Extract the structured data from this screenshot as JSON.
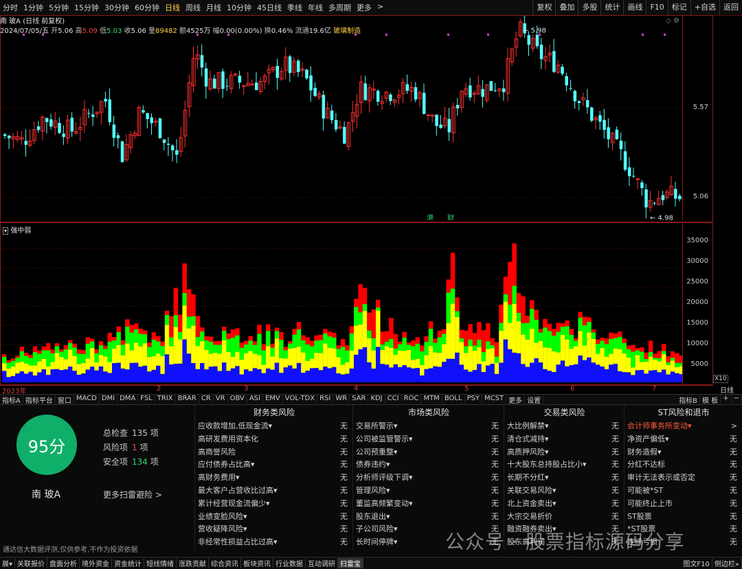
{
  "topbar": {
    "periods": [
      "分时",
      "1分钟",
      "5分钟",
      "15分钟",
      "30分钟",
      "60分钟",
      "日线",
      "周线",
      "月线",
      "10分钟",
      "45日线",
      "季线",
      "年线",
      "多周期",
      "更多"
    ],
    "active": "日线",
    "more_arrow": ">",
    "right_buttons": [
      "复权",
      "叠加",
      "多股",
      "统计",
      "画线",
      "F10",
      "标记",
      "+自选",
      "返回"
    ]
  },
  "chart_header": {
    "name": "南 玻A",
    "adj": "(日线 前复权)",
    "date": "2024/07/05/五",
    "open_label": "开",
    "open": "5.06",
    "high_label": "高",
    "high": "5.09",
    "low_label": "低",
    "low": "5.03",
    "close_label": "收",
    "close": "5.06",
    "vol_label": "量",
    "vol": "89482",
    "amt_label": "额",
    "amt": "4525万",
    "chg_label": "幅",
    "chg": "0.00(0.00%)",
    "turn_label": "换",
    "turn": "0.46%",
    "float_label": "流通",
    "float": "19.6亿",
    "industry": "玻璃制造"
  },
  "price_axis": [
    "5.57",
    "5.06"
  ],
  "annotations": {
    "high": "5.98",
    "low": "4.98",
    "marker_gang": "港",
    "marker_cai": "财"
  },
  "volume_indicator": {
    "name": "强中弱"
  },
  "volume_axis": [
    "35000",
    "30000",
    "25000",
    "20000",
    "15000",
    "10000",
    "5000"
  ],
  "volume_scale": "X10",
  "dates": {
    "start": "2023年",
    "months": [
      "2",
      "3",
      "4",
      "5",
      "6",
      "7"
    ],
    "period": "日线"
  },
  "indicators": [
    "指标A",
    "指标平台",
    "窗口",
    "MACD",
    "DMI",
    "DMA",
    "FSL",
    "TRIX",
    "BRAR",
    "CR",
    "VR",
    "OBV",
    "ASI",
    "EMV",
    "VOL-TDX",
    "RSI",
    "WR",
    "SAR",
    "KDJ",
    "CCI",
    "ROC",
    "MTM",
    "BOLL",
    "PSY",
    "MCST",
    "更多",
    "设置"
  ],
  "indicators_right": [
    "指标B",
    "模 板",
    "+",
    "−"
  ],
  "scan": {
    "score": "95分",
    "stock_name": "南 玻A",
    "total_label": "总检查",
    "total": "135",
    "total_unit": "项",
    "risk_label": "风险项",
    "risk": "1",
    "risk_unit": "项",
    "safe_label": "安全项",
    "safe": "134",
    "safe_unit": "项",
    "more": "更多扫雷避险 >",
    "disclaimer": "通达信大数据评测,仅供参考,不作为投资依据",
    "columns": [
      {
        "title": "财务类风险",
        "rows": [
          {
            "label": "应收款增加,低现金流▾",
            "value": "无"
          },
          {
            "label": "高研发费用资本化",
            "value": "无"
          },
          {
            "label": "高商誉风险",
            "value": "无"
          },
          {
            "label": "应付债券占比高▾",
            "value": "无"
          },
          {
            "label": "高财务费用▾",
            "value": "无"
          },
          {
            "label": "最大客户占营收比过高▾",
            "value": "无"
          },
          {
            "label": "累计经营现金流偏少▾",
            "value": "无"
          },
          {
            "label": "业绩变脸风险▾",
            "value": "无"
          },
          {
            "label": "营收疑降风险▾",
            "value": "无"
          },
          {
            "label": "非经常性损益占比过高▾",
            "value": "无"
          }
        ]
      },
      {
        "title": "市场类风险",
        "rows": [
          {
            "label": "交易所警示▾",
            "value": "无"
          },
          {
            "label": "公司被监管警示▾",
            "value": "无"
          },
          {
            "label": "公司预重整▾",
            "value": "无"
          },
          {
            "label": "债券违约▾",
            "value": "无"
          },
          {
            "label": "分析师评级下调▾",
            "value": "无"
          },
          {
            "label": "管理风险▾",
            "value": "无"
          },
          {
            "label": "董监高频繁变动▾",
            "value": "无"
          },
          {
            "label": "股东退出▾",
            "value": "无"
          },
          {
            "label": "子公司风险▾",
            "value": "无"
          },
          {
            "label": "长时间停牌▾",
            "value": "无"
          }
        ]
      },
      {
        "title": "交易类风险",
        "rows": [
          {
            "label": "大比例解禁▾",
            "value": "无"
          },
          {
            "label": "清仓式减持▾",
            "value": "无"
          },
          {
            "label": "高质押风险▾",
            "value": "无"
          },
          {
            "label": "十大股东总持股占比小▾",
            "value": "无"
          },
          {
            "label": "长期不分红▾",
            "value": "无"
          },
          {
            "label": "关联交易风险▾",
            "value": "无"
          },
          {
            "label": "北上资金卖出▾",
            "value": "无"
          },
          {
            "label": "大宗交易折价",
            "value": "无"
          },
          {
            "label": "融资融券卖出▾",
            "value": "无"
          },
          {
            "label": "股东高利润",
            "value": "无"
          }
        ]
      },
      {
        "title": "ST风险和退市",
        "rows": [
          {
            "label": "会计师事务所变动▾",
            "value": ">",
            "highlight": true
          },
          {
            "label": "净资产偏低▾",
            "value": "无"
          },
          {
            "label": "财务造假▾",
            "value": "无"
          },
          {
            "label": "分红不达标",
            "value": "无"
          },
          {
            "label": "审计无法表示或否定",
            "value": "无"
          },
          {
            "label": "可能被*ST",
            "value": "无"
          },
          {
            "label": "可能终止上市",
            "value": "无"
          },
          {
            "label": "ST股票",
            "value": "无"
          },
          {
            "label": "*ST股票",
            "value": "无"
          },
          {
            "label": "连续亏损",
            "value": "无"
          }
        ]
      }
    ]
  },
  "bottombar": [
    "展▾",
    "关联报价",
    "盘面分析",
    "境外资金",
    "资金统计",
    "短线情绪",
    "涨跌贡献",
    "综合资讯",
    "板块资讯",
    "行业数据",
    "互动调研",
    "扫雷宝"
  ],
  "bottombar_active": "扫雷宝",
  "bottombar_right": [
    "图文F10",
    "侧边栏»"
  ],
  "watermark": "公众号 · 股票指标源码分享",
  "colors": {
    "up": "#ff3030",
    "down": "#54ffff",
    "red": "#ff0000",
    "green": "#00ff00",
    "blue": "#1010ff",
    "yellow": "#ffff00",
    "score": "#0fae69"
  }
}
